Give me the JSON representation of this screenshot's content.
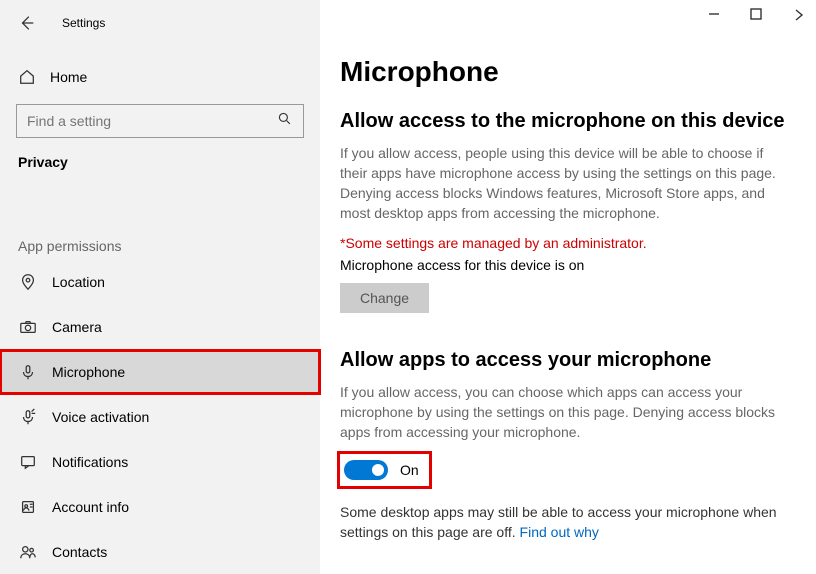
{
  "window": {
    "title": "Settings"
  },
  "sidebar": {
    "home_label": "Home",
    "search_placeholder": "Find a setting",
    "category": "Privacy",
    "section": "App permissions",
    "items": [
      {
        "label": "Location",
        "selected": false
      },
      {
        "label": "Camera",
        "selected": false
      },
      {
        "label": "Microphone",
        "selected": true
      },
      {
        "label": "Voice activation",
        "selected": false
      },
      {
        "label": "Notifications",
        "selected": false
      },
      {
        "label": "Account info",
        "selected": false
      },
      {
        "label": "Contacts",
        "selected": false
      }
    ]
  },
  "main": {
    "page_title": "Microphone",
    "section1": {
      "title": "Allow access to the microphone on this device",
      "desc": "If you allow access, people using this device will be able to choose if their apps have microphone access by using the settings on this page. Denying access blocks Windows features, Microsoft Store apps, and most desktop apps from accessing the microphone.",
      "admin_note": "*Some settings are managed by an administrator.",
      "access_line": "Microphone access for this device is on",
      "button_label": "Change"
    },
    "section2": {
      "title": "Allow apps to access your microphone",
      "desc": "If you allow access, you can choose which apps can access your microphone by using the settings on this page. Denying access blocks apps from accessing your microphone.",
      "toggle_label": "On",
      "toggle_on": true,
      "footer_text": "Some desktop apps may still be able to access your microphone when settings on this page are off. ",
      "footer_link": "Find out why"
    }
  }
}
